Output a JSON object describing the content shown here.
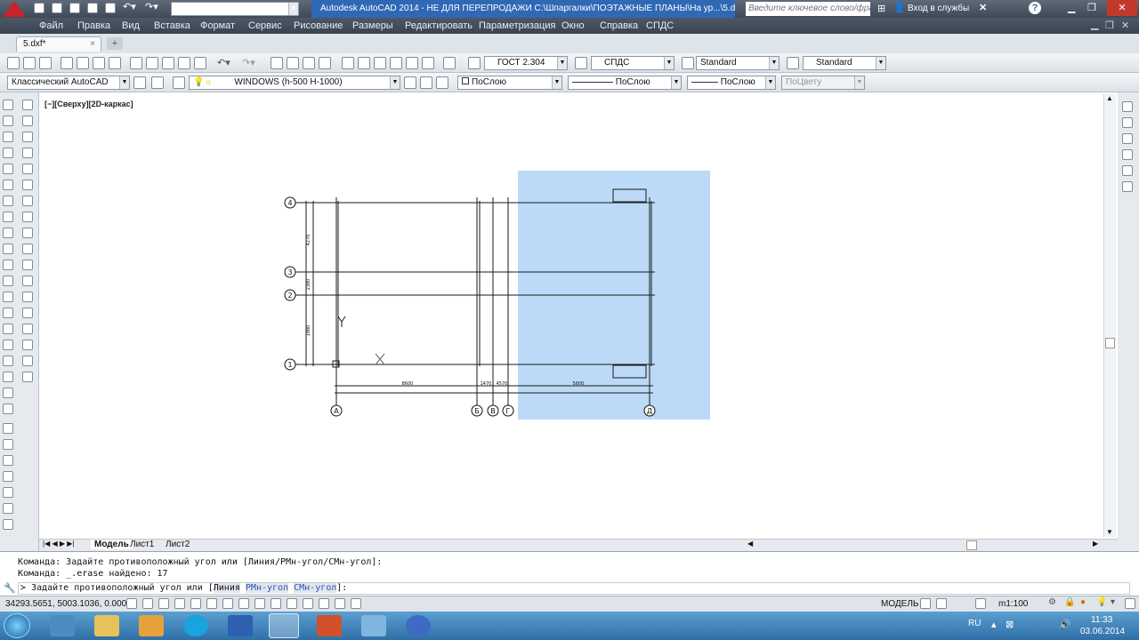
{
  "titlebar": {
    "workspace": "Классический AutoCAD",
    "title": "Autodesk AutoCAD 2014 - НЕ ДЛЯ ПЕРЕПРОДАЖИ   C:\\Шпаргалки\\ПОЭТАЖНЫЕ ПЛАНЫ\\На ур...\\5.dxf",
    "search_placeholder": "Введите ключевое слово/фразу",
    "signin": "Вход в службы"
  },
  "menu": [
    "Файл",
    "Правка",
    "Вид",
    "Вставка",
    "Формат",
    "Сервис",
    "Рисование",
    "Размеры",
    "Редактировать",
    "Параметризация",
    "Окно",
    "Справка",
    "СПДС"
  ],
  "file_tab": "5.dxf*",
  "styles": {
    "text": "ГОСТ 2.304",
    "dim": "СПДС",
    "table": "Standard",
    "mleader": "Standard"
  },
  "workspace_combo": "Классический AutoCAD",
  "layer_combo": "WINDOWS (h-500 H-1000)",
  "color_combo": "ПоСлою",
  "linetype_combo": "ПоСлою",
  "lineweight_combo": "ПоСлою",
  "plotstyle_combo": "ПоЦвету",
  "viewport_label": "[−][Сверху][2D-каркас]",
  "layout_tabs": [
    "Модель",
    "Лист1",
    "Лист2"
  ],
  "command_history": [
    "Команда: Задайте противоположный угол или [Линия/РМн-угол/СМн-угол]:",
    "Команда: _.erase найдено: 17"
  ],
  "command_prompt": "Задайте противоположный угол или [",
  "command_opts": [
    "Линия",
    "РМн-угол",
    "СМн-угол"
  ],
  "command_end": "]:",
  "status": {
    "coords": "34293.5651, 5003.1036, 0.0000",
    "model": "МОДЕЛЬ",
    "scale": "m1:100"
  },
  "tray": {
    "lang": "RU",
    "time": "11:33",
    "date": "03.06.2014"
  },
  "drawing": {
    "axes_bottom": [
      "А",
      "Б",
      "В",
      "Г",
      "Д"
    ],
    "axes_left": [
      "4",
      "3",
      "2",
      "1"
    ],
    "dims": [
      "4270",
      "2380",
      "1980",
      "8600",
      "1470",
      "4570",
      "5800"
    ]
  },
  "colors": {
    "selection": "#bcd9f7",
    "title_bg": "#3f4957"
  }
}
